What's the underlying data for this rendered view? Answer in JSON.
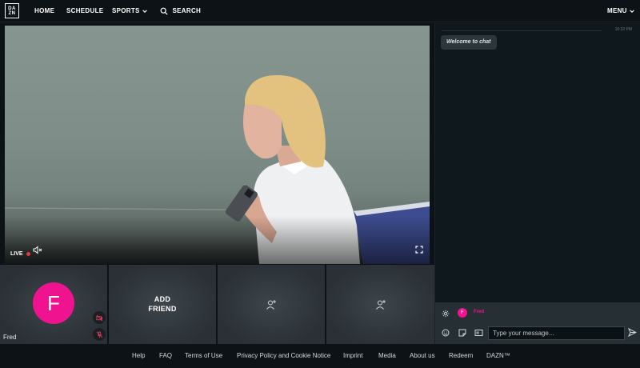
{
  "nav": {
    "logo_top": "DA",
    "logo_bottom": "ZN",
    "home": "HOME",
    "schedule": "SCHEDULE",
    "sports": "SPORTS",
    "search": "SEARCH",
    "menu": "MENU"
  },
  "player": {
    "live_label": "LIVE"
  },
  "tiles": {
    "user_initial": "F",
    "user_name": "Fred",
    "add_friend": "ADD\nFRIEND"
  },
  "chat": {
    "time": "10:32 PM",
    "welcome": "Welcome to chat",
    "user_initial": "F",
    "user_name": "Fred",
    "input_placeholder": "Type your message..."
  },
  "footer": {
    "links": [
      "Help",
      "FAQ",
      "Terms of Use",
      "Privacy Policy and Cookie Notice",
      "Imprint",
      "Media",
      "About us",
      "Redeem",
      "DAZN™"
    ]
  },
  "colors": {
    "accent": "#f0138f",
    "background": "#0c1216",
    "live": "#e23b3b"
  }
}
